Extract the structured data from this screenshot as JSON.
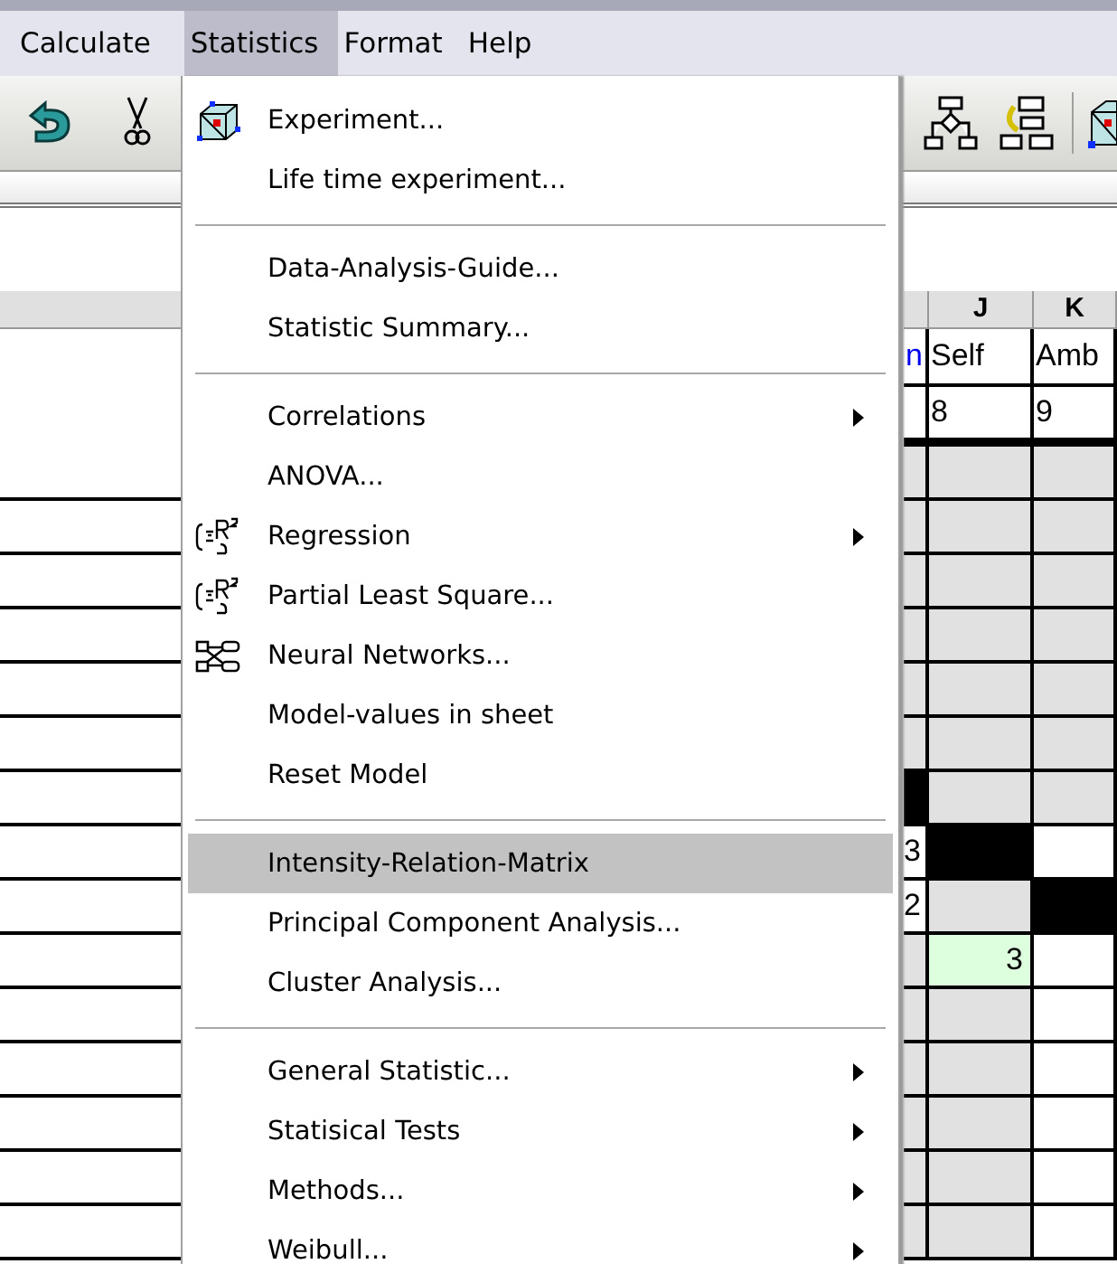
{
  "menubar": [
    {
      "label": "Calculate",
      "selected": false
    },
    {
      "label": "Statistics",
      "selected": true
    },
    {
      "label": "Format",
      "selected": false
    },
    {
      "label": "Help",
      "selected": false
    }
  ],
  "menu": {
    "items": [
      {
        "kind": "cube",
        "label": "Experiment...",
        "submenu": false,
        "selected": false
      },
      {
        "kind": "item",
        "label": "Life time experiment...",
        "submenu": false,
        "selected": false
      },
      {
        "kind": "separator"
      },
      {
        "kind": "item",
        "label": "Data-Analysis-Guide...",
        "submenu": false,
        "selected": false
      },
      {
        "kind": "item",
        "label": "Statistic Summary...",
        "submenu": false,
        "selected": false
      },
      {
        "kind": "separator"
      },
      {
        "kind": "item",
        "label": "Correlations",
        "submenu": true,
        "selected": false
      },
      {
        "kind": "item",
        "label": "ANOVA...",
        "submenu": false,
        "selected": false
      },
      {
        "kind": "formula",
        "label": "Regression",
        "submenu": true,
        "selected": false
      },
      {
        "kind": "formula",
        "label": "Partial Least Square...",
        "submenu": false,
        "selected": false
      },
      {
        "kind": "network",
        "label": "Neural Networks...",
        "submenu": false,
        "selected": false
      },
      {
        "kind": "item",
        "label": "Model-values in sheet",
        "submenu": false,
        "selected": false
      },
      {
        "kind": "item",
        "label": "Reset Model",
        "submenu": false,
        "selected": false
      },
      {
        "kind": "separator"
      },
      {
        "kind": "item",
        "label": "Intensity-Relation-Matrix",
        "submenu": false,
        "selected": true
      },
      {
        "kind": "item",
        "label": "Principal Component Analysis...",
        "submenu": false,
        "selected": false
      },
      {
        "kind": "item",
        "label": "Cluster Analysis...",
        "submenu": false,
        "selected": false
      },
      {
        "kind": "separator"
      },
      {
        "kind": "item",
        "label": "General Statistic...",
        "submenu": true,
        "selected": false
      },
      {
        "kind": "item",
        "label": "Statisical Tests",
        "submenu": true,
        "selected": false
      },
      {
        "kind": "item",
        "label": "Methods...",
        "submenu": true,
        "selected": false
      },
      {
        "kind": "item",
        "label": "Weibull...",
        "submenu": true,
        "selected": false
      }
    ]
  },
  "sheet": {
    "columns": [
      {},
      {
        "label": "J"
      },
      {
        "label": "K"
      }
    ],
    "rows": [
      {
        "cells": [
          {
            "text": "n",
            "color": "#ffffff"
          },
          {
            "text": "Self",
            "color": "#ffffff"
          },
          {
            "text": "Amb",
            "color": "#ffffff"
          }
        ]
      },
      {
        "cells": [
          {
            "color": "#ffffff"
          },
          {
            "text": "8",
            "color": "#ffffff"
          },
          {
            "text": "9",
            "color": "#ffffff"
          }
        ]
      },
      {
        "cells": [
          {
            "color": "#e1e1e1"
          },
          {
            "color": "#e1e1e1"
          },
          {
            "color": "#e1e1e1"
          }
        ]
      },
      {
        "cells": [
          {
            "color": "#e1e1e1"
          },
          {
            "color": "#e1e1e1"
          },
          {
            "color": "#e1e1e1"
          }
        ]
      },
      {
        "cells": [
          {
            "color": "#e1e1e1"
          },
          {
            "color": "#e1e1e1"
          },
          {
            "color": "#e1e1e1"
          }
        ]
      },
      {
        "cells": [
          {
            "color": "#e1e1e1"
          },
          {
            "color": "#e1e1e1"
          },
          {
            "color": "#e1e1e1"
          }
        ]
      },
      {
        "cells": [
          {
            "color": "#e1e1e1"
          },
          {
            "color": "#e1e1e1"
          },
          {
            "color": "#e1e1e1"
          }
        ]
      },
      {
        "cells": [
          {
            "color": "#e1e1e1"
          },
          {
            "color": "#e1e1e1"
          },
          {
            "color": "#e1e1e1"
          }
        ]
      },
      {
        "cells": [
          {
            "color": "#000000"
          },
          {
            "color": "#e1e1e1"
          },
          {
            "color": "#e1e1e1"
          }
        ]
      },
      {
        "cells": [
          {
            "text": "3",
            "color": "#ffffff"
          },
          {
            "color": "#000000"
          },
          {
            "color": "#ffffff"
          }
        ]
      },
      {
        "cells": [
          {
            "text": "2",
            "color": "#ffffff"
          },
          {
            "color": "#e1e1e1"
          },
          {
            "color": "#000000"
          }
        ]
      },
      {
        "cells": [
          {
            "color": "#e1e1e1"
          },
          {
            "text": "3",
            "color": "#ddffdd"
          },
          {
            "color": "#ffffff"
          }
        ]
      },
      {
        "cells": [
          {
            "color": "#e1e1e1"
          },
          {
            "color": "#e1e1e1"
          },
          {
            "color": "#ffffff"
          }
        ]
      },
      {
        "cells": [
          {
            "color": "#e1e1e1"
          },
          {
            "color": "#e1e1e1"
          },
          {
            "color": "#ffffff"
          }
        ]
      },
      {
        "cells": [
          {
            "color": "#e1e1e1"
          },
          {
            "color": "#e1e1e1"
          },
          {
            "color": "#ffffff"
          }
        ]
      },
      {
        "cells": [
          {
            "color": "#e1e1e1"
          },
          {
            "color": "#e1e1e1"
          },
          {
            "color": "#ffffff"
          }
        ]
      },
      {
        "cells": [
          {
            "color": "#e1e1e1"
          },
          {
            "color": "#e1e1e1"
          },
          {
            "color": "#ffffff"
          }
        ]
      }
    ]
  }
}
